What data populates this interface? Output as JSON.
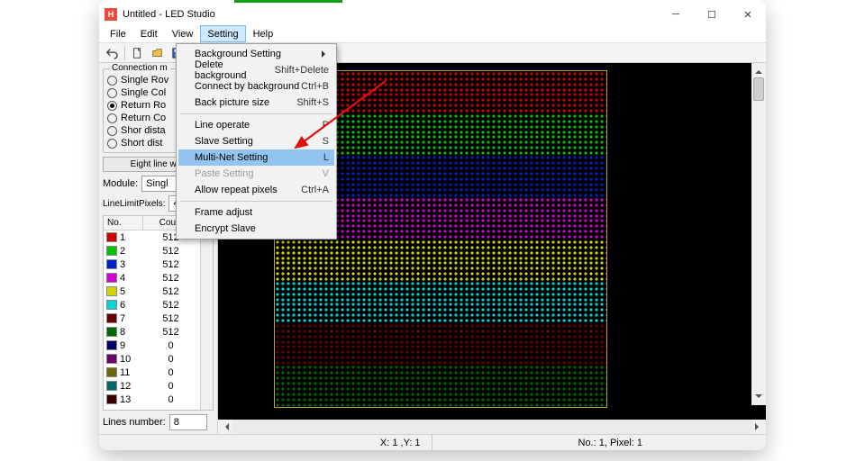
{
  "app": {
    "title": "Untitled - LED Studio",
    "icon_letter": "H"
  },
  "menus": [
    "File",
    "Edit",
    "View",
    "Setting",
    "Help"
  ],
  "active_menu_index": 3,
  "dropdown": [
    {
      "label": "Background Setting",
      "sub": true
    },
    {
      "label": "Delete background",
      "accel": "Shift+Delete"
    },
    {
      "label": "Connect by background",
      "accel": "Ctrl+B"
    },
    {
      "label": "Back picture size",
      "accel": "Shift+S"
    },
    {
      "sep": true
    },
    {
      "label": "Line operate",
      "accel": "P"
    },
    {
      "label": "Slave Setting",
      "accel": "S"
    },
    {
      "label": "Multi-Net Setting",
      "accel": "L",
      "hl": true
    },
    {
      "label": "Paste Setting",
      "accel": "V",
      "disabled": true
    },
    {
      "label": "Allow repeat pixels",
      "accel": "Ctrl+A"
    },
    {
      "sep": true
    },
    {
      "label": "Frame adjust"
    },
    {
      "label": "Encrypt Slave"
    }
  ],
  "panel": {
    "group_title": "Connection m",
    "radios": [
      {
        "label": "Single Rov",
        "checked": false
      },
      {
        "label": "Single Col",
        "checked": false
      },
      {
        "label": "Return Ro",
        "checked": true
      },
      {
        "label": "Return Co",
        "checked": false
      },
      {
        "label": "Shor dista",
        "checked": false
      },
      {
        "label": "Short dist",
        "checked": false
      }
    ],
    "eight_btn": "Eight line with",
    "module_label": "Module:",
    "module_value": "Singl",
    "linelimit_label": "LineLimitPixels:",
    "linelimit_value": "4096",
    "table_headers": {
      "no": "No.",
      "count": "Count"
    },
    "rows": [
      {
        "no": 1,
        "count": 512,
        "color": "#d40000"
      },
      {
        "no": 2,
        "count": 512,
        "color": "#00c400"
      },
      {
        "no": 3,
        "count": 512,
        "color": "#0020c8"
      },
      {
        "no": 4,
        "count": 512,
        "color": "#d400d4"
      },
      {
        "no": 5,
        "count": 512,
        "color": "#d4d400"
      },
      {
        "no": 6,
        "count": 512,
        "color": "#00d4d4"
      },
      {
        "no": 7,
        "count": 512,
        "color": "#6a0000"
      },
      {
        "no": 8,
        "count": 512,
        "color": "#006a00"
      },
      {
        "no": 9,
        "count": 0,
        "color": "#00006a"
      },
      {
        "no": 10,
        "count": 0,
        "color": "#6a006a"
      },
      {
        "no": 11,
        "count": 0,
        "color": "#6a6a00"
      },
      {
        "no": 12,
        "count": 0,
        "color": "#006a6a"
      },
      {
        "no": 13,
        "count": 0,
        "color": "#3a0000"
      }
    ],
    "lines_label": "Lines number:",
    "lines_value": "8"
  },
  "status": {
    "xy": "X: 1 ,Y: 1",
    "np": "No.: 1, Pixel: 1"
  },
  "bands": [
    "#d40000",
    "#d40000",
    "#00c400",
    "#00c400",
    "#0020c8",
    "#0020c8",
    "#d400d4",
    "#d400d4",
    "#d4d400",
    "#d4d400",
    "#00d4d4",
    "#00d4d4",
    "#6a0000",
    "#6a0000",
    "#006a00",
    "#006a00"
  ]
}
